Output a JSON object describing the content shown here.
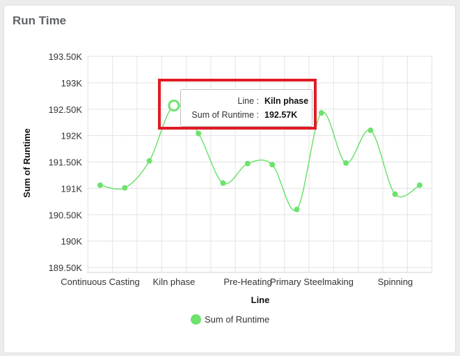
{
  "card": {
    "title": "Run Time"
  },
  "chart_data": {
    "type": "line",
    "title": "",
    "xlabel": "Line",
    "ylabel": "Sum of Runtime",
    "ylim": [
      189500,
      193500
    ],
    "yticks": [
      "193.50K",
      "193K",
      "192.50K",
      "192K",
      "191.50K",
      "191K",
      "190.50K",
      "190K",
      "189.50K"
    ],
    "xtick_labels": [
      "Continuous Casting",
      "Kiln phase",
      "Pre-Heating",
      "Primary Steelmaking",
      "Spinning"
    ],
    "grid": true,
    "legend_position": "bottom",
    "series": [
      {
        "name": "Sum of Runtime",
        "color": "#6de26d",
        "values": [
          191060,
          191010,
          191520,
          192570,
          192040,
          191100,
          191470,
          191450,
          190600,
          192430,
          191480,
          192100,
          190890,
          191060
        ]
      }
    ]
  },
  "tooltip": {
    "line_label": "Line :",
    "line_value": "Kiln phase",
    "runtime_label": "Sum of Runtime :",
    "runtime_value": "192.57K"
  },
  "legend": {
    "label": "Sum of Runtime"
  }
}
